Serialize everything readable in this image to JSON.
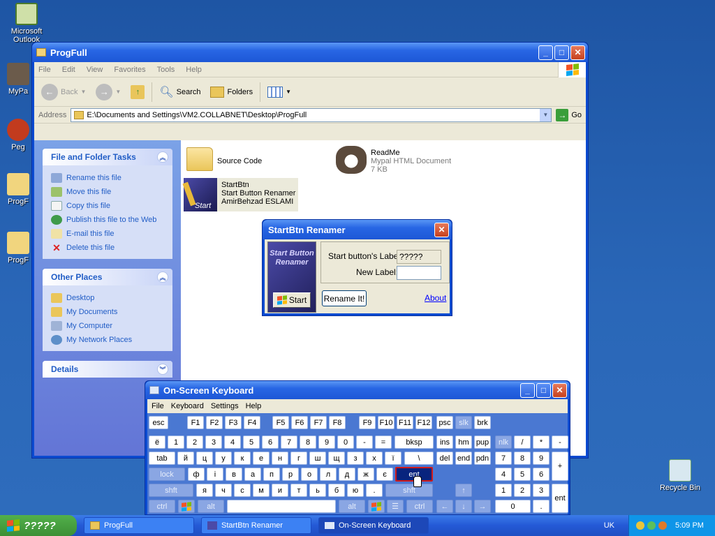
{
  "desktop": {
    "icons": [
      {
        "label": "Microsoft Outlook"
      },
      {
        "label": "MyPa"
      },
      {
        "label": "Peg"
      },
      {
        "label": "ProgF"
      },
      {
        "label": "ProgF"
      },
      {
        "label": "Recycle Bin"
      }
    ]
  },
  "explorer": {
    "title": "ProgFull",
    "menu": [
      "File",
      "Edit",
      "View",
      "Favorites",
      "Tools",
      "Help"
    ],
    "toolbar": {
      "back": "Back",
      "search": "Search",
      "folders": "Folders"
    },
    "address_label": "Address",
    "address_value": "E:\\Documents and Settings\\VM2.COLLABNET\\Desktop\\ProgFull",
    "go": "Go",
    "panels": {
      "file_tasks": {
        "title": "File and Folder Tasks",
        "items": [
          "Rename this file",
          "Move this file",
          "Copy this file",
          "Publish this file to the Web",
          "E-mail this file",
          "Delete this file"
        ]
      },
      "other_places": {
        "title": "Other Places",
        "items": [
          "Desktop",
          "My Documents",
          "My Computer",
          "My Network Places"
        ]
      },
      "details": {
        "title": "Details"
      }
    },
    "files": [
      {
        "name": "Source Code"
      },
      {
        "name": "ReadMe",
        "type": "Mypal HTML Document",
        "size": "7 KB"
      },
      {
        "name": "StartBtn",
        "desc": "Start Button Renamer",
        "author": "AmirBehzad ESLAMI",
        "overlay": "Start"
      }
    ]
  },
  "dialog": {
    "title": "StartBtn Renamer",
    "logo_text": "Start Button Renamer",
    "start_button": "Start",
    "current_label_caption": "Start button's Label:",
    "current_label_value": "?????",
    "new_label_caption": "New Label:",
    "new_label_value": "",
    "rename_button": "Rename It!",
    "about_link": "About"
  },
  "osk": {
    "title": "On-Screen Keyboard",
    "menu": [
      "File",
      "Keyboard",
      "Settings",
      "Help"
    ]
  },
  "taskbar": {
    "start_label": "?????",
    "tasks": [
      "ProgFull",
      "StartBtn Renamer",
      "On-Screen Keyboard"
    ],
    "language": "UK",
    "clock": "5:09 PM"
  },
  "colors": {
    "accent": "#0b4bd1",
    "desktop": "#235fa6",
    "link": "#215dc6"
  }
}
